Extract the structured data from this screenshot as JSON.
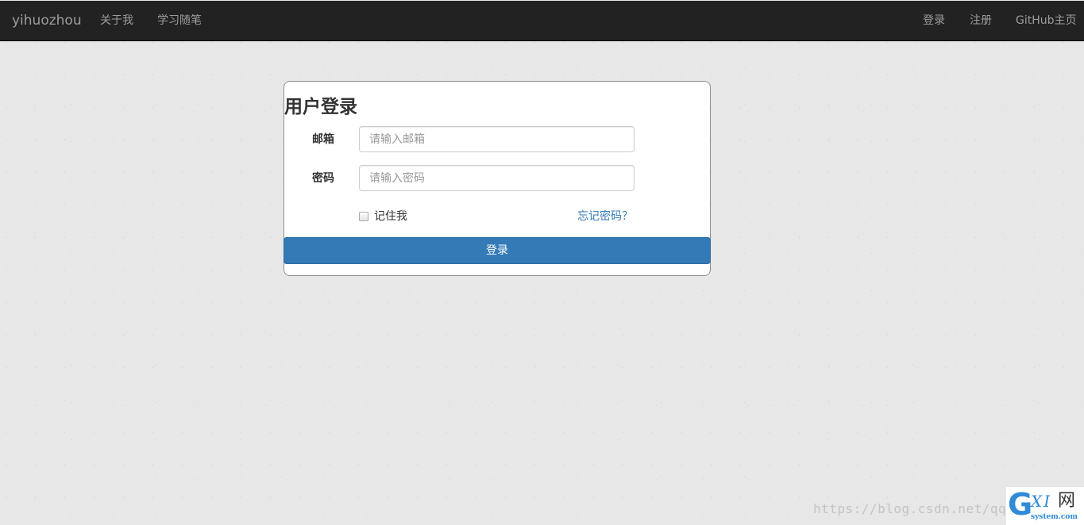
{
  "navbar": {
    "brand": "yihuozhou",
    "left_links": [
      "关于我",
      "学习随笔"
    ],
    "right_links": [
      "登录",
      "注册",
      "GitHub主页"
    ]
  },
  "login": {
    "title": "用户登录",
    "email_label": "邮箱",
    "email_placeholder": "请输入邮箱",
    "email_value": "",
    "password_label": "密码",
    "password_placeholder": "请输入密码",
    "password_value": "",
    "remember_label": "记住我",
    "remember_checked": false,
    "forgot_label": "忘记密码？",
    "submit_label": "登录"
  },
  "watermark": {
    "url_text": "https://blog.csdn.net/qq",
    "logo_letters": "GXI",
    "logo_cn": "网",
    "logo_domain": "system.com"
  },
  "colors": {
    "navbar_bg": "#222222",
    "nav_text": "#9d9d9d",
    "primary": "#337ab7",
    "link": "#337ab7",
    "page_bg": "#e7e7e7"
  }
}
